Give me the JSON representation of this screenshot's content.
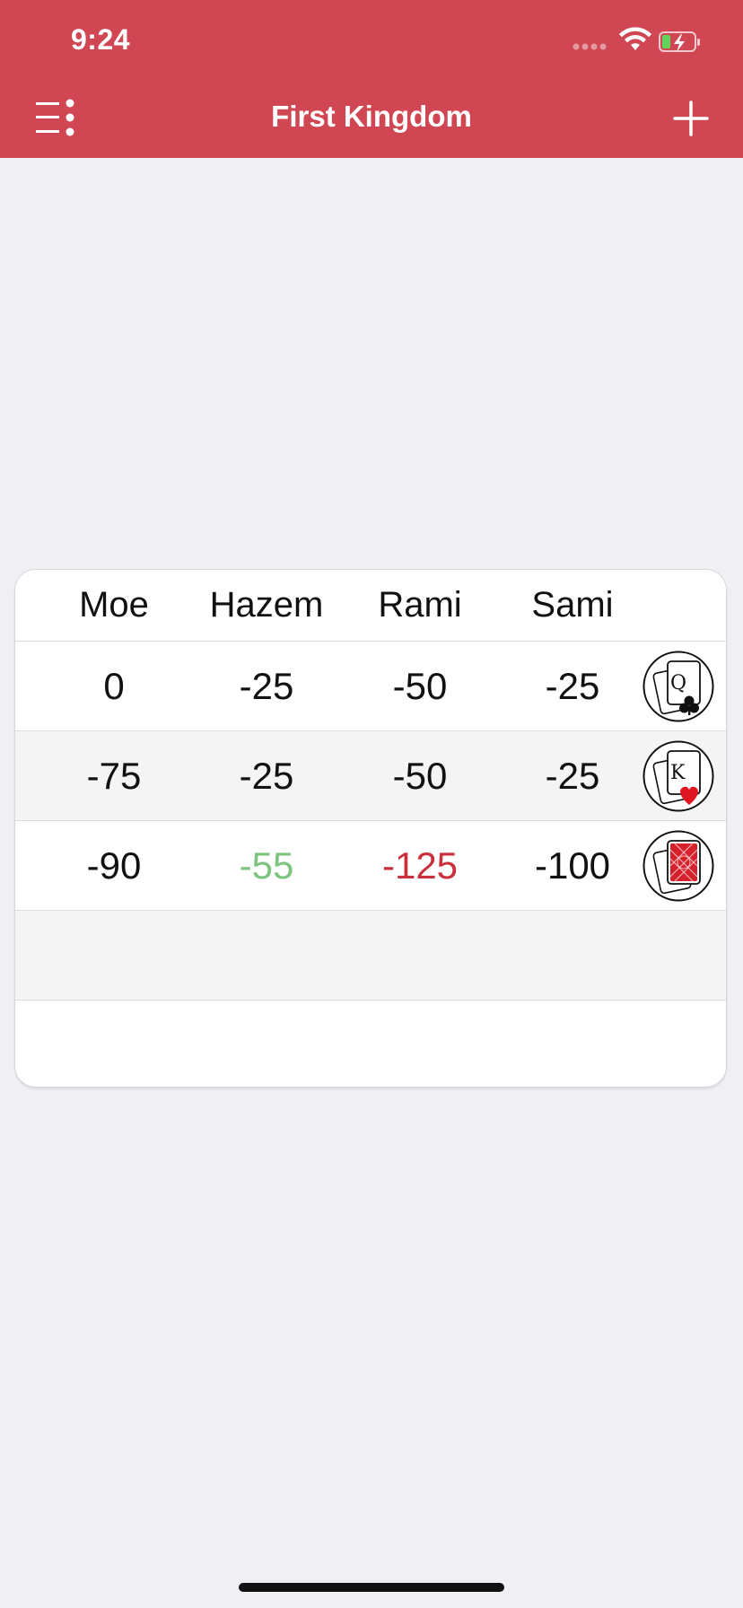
{
  "status_bar": {
    "time": "9:24"
  },
  "nav": {
    "title": "First Kingdom"
  },
  "table": {
    "players": [
      "Moe",
      "Hazem",
      "Rami",
      "Sami"
    ],
    "rows": [
      {
        "scores": [
          "0",
          "-25",
          "-50",
          "-25"
        ],
        "card_icon": "queen-of-clubs-icon",
        "card_letter": "Q"
      },
      {
        "scores": [
          "-75",
          "-25",
          "-50",
          "-25"
        ],
        "card_icon": "king-of-hearts-icon",
        "card_letter": "K"
      },
      {
        "scores": [
          "-90",
          "-55",
          "-125",
          "-100"
        ],
        "card_icon": "card-back-icon"
      }
    ],
    "highlight": {
      "lowest": "-55",
      "highest": "-125"
    }
  },
  "colors": {
    "nav_bar": "#d04652",
    "background": "#efeff4",
    "score_best": "#7dc47f",
    "score_worst": "#c9303c"
  }
}
